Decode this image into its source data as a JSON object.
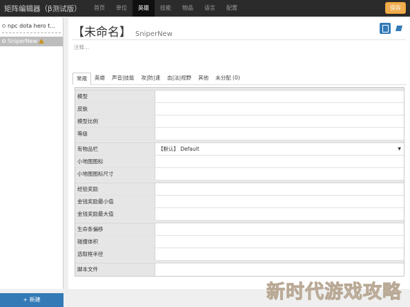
{
  "app": {
    "title": "矩阵编辑器（β测试版）"
  },
  "nav": {
    "items": [
      "首页",
      "单位",
      "英雄",
      "技能",
      "物品",
      "语言",
      "配置"
    ],
    "active_index": 2
  },
  "toolbar": {
    "save_label": "保存"
  },
  "sidebar": {
    "items": [
      {
        "label": "npc dota hero t...",
        "selected": false,
        "warning": false
      },
      {
        "label": "SniperNew",
        "selected": true,
        "warning": true
      }
    ],
    "new_label": "+ 新建"
  },
  "editor": {
    "title": "【未命名】",
    "subtitle": "SniperNew",
    "note_placeholder": "注释...",
    "icons": [
      "document-icon",
      "book-icon"
    ]
  },
  "tabs": {
    "items": [
      "常规",
      "英雄",
      "声音|技能",
      "攻|防|速",
      "血|法|视野",
      "其他",
      "未分配 (0)"
    ],
    "active_index": 0
  },
  "properties": {
    "groups": [
      [
        {
          "label": "模型",
          "value": ""
        },
        {
          "label": "皮肤",
          "value": ""
        },
        {
          "label": "模型比例",
          "value": ""
        },
        {
          "label": "等级",
          "value": ""
        }
      ],
      [
        {
          "label": "有物品栏",
          "value": "【默认】 Default",
          "dropdown": true
        },
        {
          "label": "小地图图标",
          "value": ""
        },
        {
          "label": "小地图图标尺寸",
          "value": ""
        }
      ],
      [
        {
          "label": "经验奖励",
          "value": ""
        },
        {
          "label": "金钱奖励最小值",
          "value": ""
        },
        {
          "label": "金钱奖励最大值",
          "value": ""
        }
      ],
      [
        {
          "label": "生命条偏移",
          "value": ""
        },
        {
          "label": "碰撞体积",
          "value": ""
        },
        {
          "label": "选取框半径",
          "value": ""
        }
      ],
      [
        {
          "label": "脚本文件",
          "value": ""
        }
      ]
    ]
  },
  "watermark": {
    "text": "新时代游戏攻略"
  },
  "colors": {
    "topbar": "#2b2b2b",
    "save": "#f0ad4e",
    "primary": "#337ab7"
  }
}
